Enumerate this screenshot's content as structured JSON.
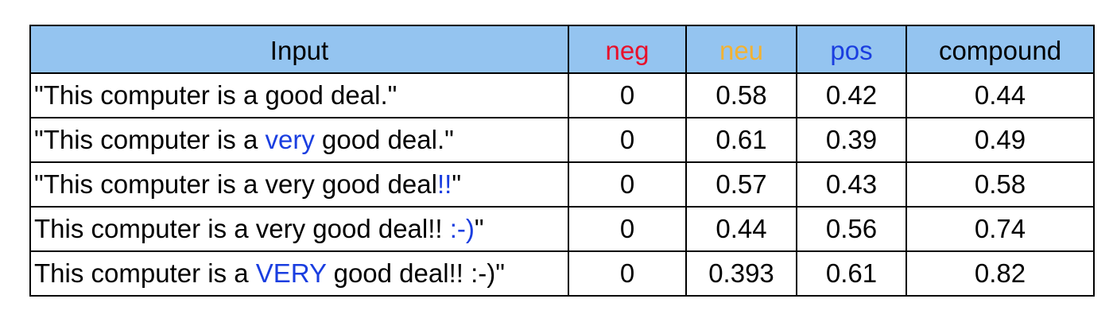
{
  "headers": {
    "input": {
      "label": "Input",
      "color": "#000000"
    },
    "neg": {
      "label": "neg",
      "color": "#e8102a"
    },
    "neu": {
      "label": "neu",
      "color": "#f2b233"
    },
    "pos": {
      "label": "pos",
      "color": "#1a3ee0"
    },
    "compound": {
      "label": "compound",
      "color": "#000000"
    }
  },
  "colors": {
    "header_bg": "#94c4f0",
    "highlight": "#1a3ee0",
    "border": "#000000"
  },
  "rows": [
    {
      "input": [
        {
          "text": "\"This computer is a good deal.\"",
          "highlight": false
        }
      ],
      "neg": "0",
      "neu": "0.58",
      "pos": "0.42",
      "compound": "0.44"
    },
    {
      "input": [
        {
          "text": "\"This computer is a ",
          "highlight": false
        },
        {
          "text": "very",
          "highlight": true
        },
        {
          "text": " good deal.\"",
          "highlight": false
        }
      ],
      "neg": "0",
      "neu": "0.61",
      "pos": "0.39",
      "compound": "0.49"
    },
    {
      "input": [
        {
          "text": "\"This computer is a very good deal",
          "highlight": false
        },
        {
          "text": "!!",
          "highlight": true
        },
        {
          "text": "\"",
          "highlight": false
        }
      ],
      "neg": "0",
      "neu": "0.57",
      "pos": "0.43",
      "compound": "0.58"
    },
    {
      "input": [
        {
          "text": "This computer is a very good deal!! ",
          "highlight": false
        },
        {
          "text": ":-)",
          "highlight": true
        },
        {
          "text": "\"",
          "highlight": false
        }
      ],
      "neg": "0",
      "neu": "0.44",
      "pos": "0.56",
      "compound": "0.74"
    },
    {
      "input": [
        {
          "text": "This computer is a ",
          "highlight": false
        },
        {
          "text": "VERY",
          "highlight": true
        },
        {
          "text": " good deal!! :-)\"",
          "highlight": false
        }
      ],
      "neg": "0",
      "neu": "0.393",
      "pos": "0.61",
      "compound": "0.82"
    }
  ]
}
